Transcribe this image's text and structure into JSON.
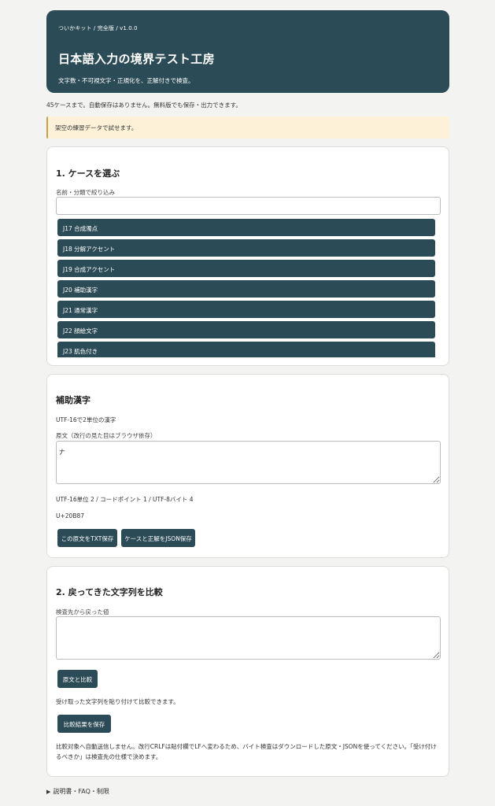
{
  "header": {
    "breadcrumb": "ついかキット / 完全版 / v1.0.0",
    "title": "日本語入力の境界テスト工房",
    "subtitle": "文字数・不可視文字・正規化を、正解付きで検査。"
  },
  "notice": "45ケースまで。自動保存はありません。無料版でも保存・出力できます。",
  "banner": "架空の練習データで試せます。",
  "case_select": {
    "heading": "1. ケースを選ぶ",
    "filter_label": "名前・分類で絞り込み",
    "filter_value": "",
    "items": [
      {
        "label": "J17 合成濁点"
      },
      {
        "label": "J18 分解アクセント"
      },
      {
        "label": "J19 合成アクセント"
      },
      {
        "label": "J20 補助漢字"
      },
      {
        "label": "J21 通常漢字"
      },
      {
        "label": "J22 顔絵文字"
      },
      {
        "label": "J23 肌色付き"
      }
    ]
  },
  "case_detail": {
    "title": "補助漢字",
    "description": "UTF-16で2単位の漢字",
    "source_label": "原文（改行の見た目はブラウザ依存）",
    "source_value": "𠂇",
    "stats": "UTF-16単位 2 / コードポイント 1 / UTF-8バイト 4",
    "codepoint": "U+20B87",
    "save_txt_button": "この原文をTXT保存",
    "save_json_button": "ケースと正解をJSON保存"
  },
  "compare": {
    "heading": "2. 戻ってきた文字列を比較",
    "returned_label": "検査先から戻った値",
    "returned_value": "",
    "compare_button": "原文と比較",
    "hint": "受け取った文字列を貼り付けて比較できます。",
    "save_result_button": "比較結果を保存",
    "footnote": "比較対象へ自動送信しません。改行CRLFは貼付欄でLFへ変わるため、バイト検査はダウンロードした原文・JSONを使ってください。「受け付けるべきか」は検査先の仕様で決めます。"
  },
  "footer": {
    "toggle": "説明書・FAQ・制限"
  },
  "colors": {
    "primary": "#2b4b56",
    "background": "#f3f3f1",
    "banner_bg": "#fdf2d8",
    "banner_border": "#c8a24a"
  }
}
